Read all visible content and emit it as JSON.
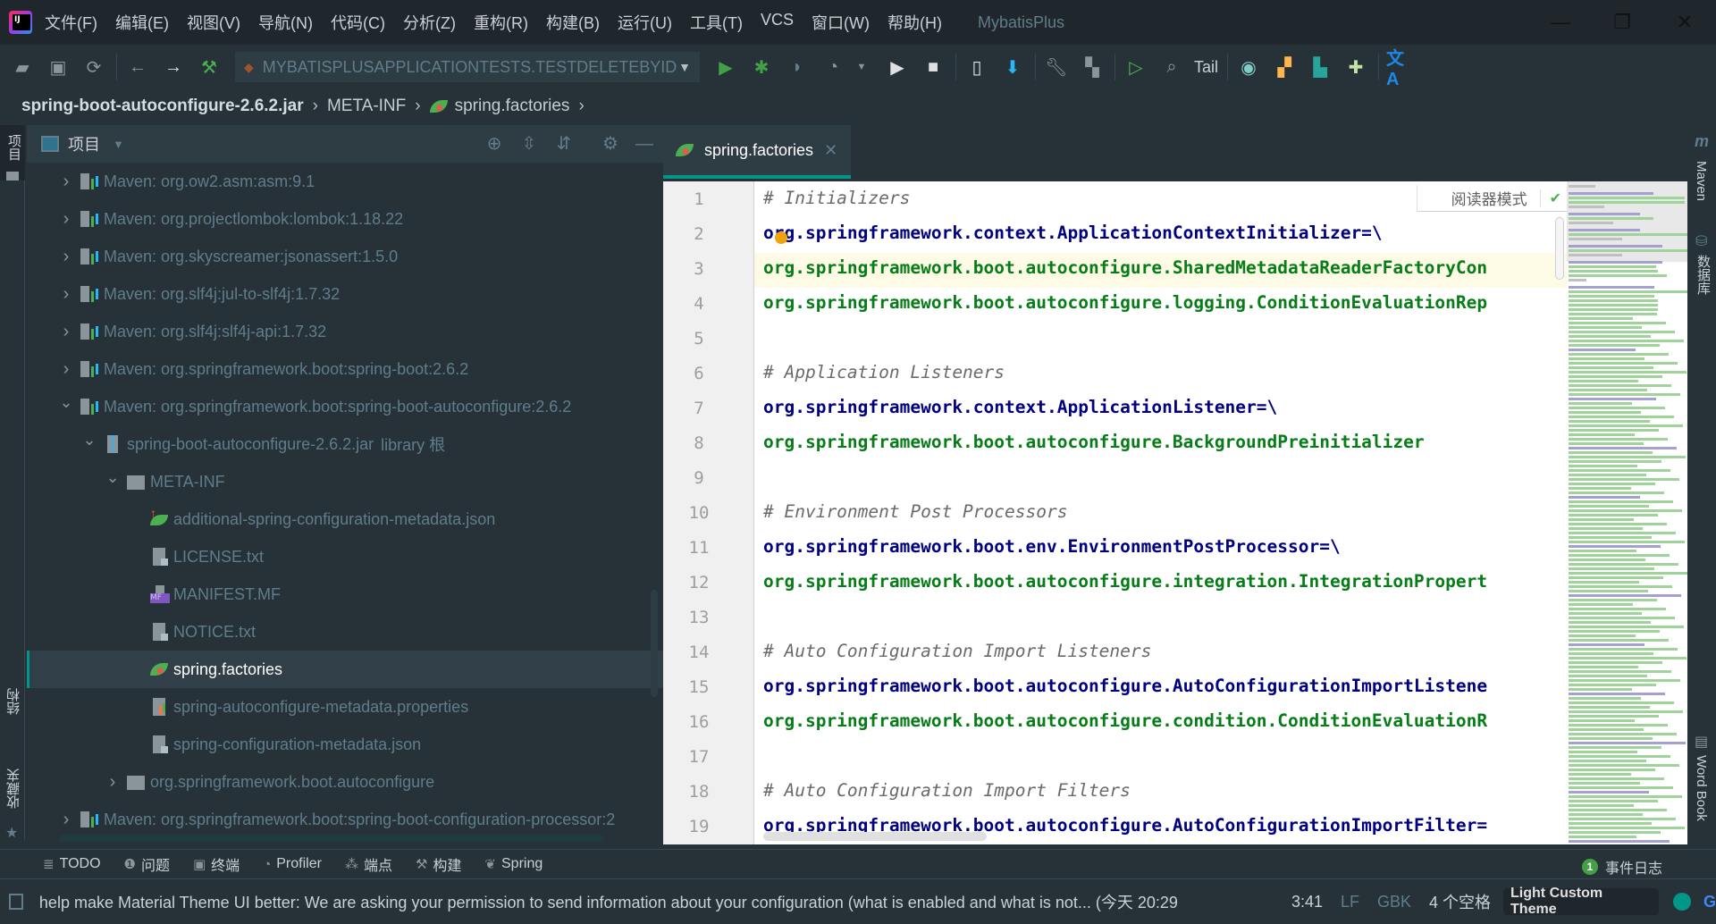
{
  "titlebar": {
    "menu": [
      "文件(F)",
      "编辑(E)",
      "视图(V)",
      "导航(N)",
      "代码(C)",
      "分析(Z)",
      "重构(R)",
      "构建(B)",
      "运行(U)",
      "工具(T)",
      "VCS",
      "窗口(W)",
      "帮助(H)"
    ],
    "project_name": "MybatisPlus",
    "controls": {
      "minimize": "—",
      "restore": "❐",
      "close": "✕"
    }
  },
  "toolbar": {
    "run_config": "MYBATISPLUSAPPLICATIONTESTS.TESTDELETEBYID",
    "tail_label": "Tail",
    "icons": [
      "open-folder-icon",
      "save-icon",
      "sync-icon",
      "back-icon",
      "forward-icon",
      "build-hammer-icon",
      "run-icon",
      "debug-icon",
      "coverage-icon",
      "profile-icon",
      "resume-icon",
      "stop-icon",
      "device-manager-icon",
      "sdk-download-icon",
      "settings-wrench-icon",
      "project-structure-icon",
      "run-anything-icon",
      "search-icon",
      "record-icon",
      "layout-icon",
      "mysql-icon",
      "plugin-icon",
      "translate-icon"
    ]
  },
  "breadcrumb": [
    "spring-boot-autoconfigure-2.6.2.jar",
    "META-INF",
    "spring.factories"
  ],
  "left_strip": {
    "project": "项目",
    "structure": "结构",
    "favorites": "收藏夹"
  },
  "project_panel": {
    "title": "项目",
    "tree": [
      {
        "label": "Maven: org.ow2.asm:asm:9.1",
        "type": "maven",
        "level": 0,
        "expanded": false
      },
      {
        "label": "Maven: org.projectlombok:lombok:1.18.22",
        "type": "maven",
        "level": 0,
        "expanded": false
      },
      {
        "label": "Maven: org.skyscreamer:jsonassert:1.5.0",
        "type": "maven",
        "level": 0,
        "expanded": false
      },
      {
        "label": "Maven: org.slf4j:jul-to-slf4j:1.7.32",
        "type": "maven",
        "level": 0,
        "expanded": false
      },
      {
        "label": "Maven: org.slf4j:slf4j-api:1.7.32",
        "type": "maven",
        "level": 0,
        "expanded": false
      },
      {
        "label": "Maven: org.springframework.boot:spring-boot:2.6.2",
        "type": "maven",
        "level": 0,
        "expanded": false
      },
      {
        "label": "Maven: org.springframework.boot:spring-boot-autoconfigure:2.6.2",
        "type": "maven",
        "level": 0,
        "expanded": true
      },
      {
        "label": "spring-boot-autoconfigure-2.6.2.jar",
        "suffix": "library 根",
        "type": "jar",
        "level": 1,
        "expanded": true
      },
      {
        "label": "META-INF",
        "type": "folder",
        "level": 2,
        "expanded": true
      },
      {
        "label": "additional-spring-configuration-metadata.json",
        "type": "addjson",
        "level": 3
      },
      {
        "label": "LICENSE.txt",
        "type": "file",
        "level": 3
      },
      {
        "label": "MANIFEST.MF",
        "type": "mf",
        "level": 3
      },
      {
        "label": "NOTICE.txt",
        "type": "file",
        "level": 3
      },
      {
        "label": "spring.factories",
        "type": "spring",
        "level": 3,
        "selected": true
      },
      {
        "label": "spring-autoconfigure-metadata.properties",
        "type": "props",
        "level": 3
      },
      {
        "label": "spring-configuration-metadata.json",
        "type": "file",
        "level": 3
      },
      {
        "label": "org.springframework.boot.autoconfigure",
        "type": "folder",
        "level": 2,
        "expanded": false
      },
      {
        "label": "Maven: org.springframework.boot:spring-boot-configuration-processor:2",
        "type": "maven",
        "level": 0,
        "expanded": false
      }
    ]
  },
  "editor": {
    "tab_label": "spring.factories",
    "reader_mode": "阅读器模式",
    "current_line": 3,
    "lines": [
      {
        "n": "1",
        "kind": "comment",
        "text": "# Initializers"
      },
      {
        "n": "2",
        "kind": "key",
        "text": "org.springframework.context.ApplicationContextInitializer=\\"
      },
      {
        "n": "3",
        "kind": "val",
        "text": "org.springframework.boot.autoconfigure.SharedMetadataReaderFactoryCon"
      },
      {
        "n": "4",
        "kind": "val",
        "text": "org.springframework.boot.autoconfigure.logging.ConditionEvaluationRep"
      },
      {
        "n": "5",
        "kind": "blank",
        "text": ""
      },
      {
        "n": "6",
        "kind": "comment",
        "text": "# Application Listeners"
      },
      {
        "n": "7",
        "kind": "key",
        "text": "org.springframework.context.ApplicationListener=\\"
      },
      {
        "n": "8",
        "kind": "val",
        "text": "org.springframework.boot.autoconfigure.BackgroundPreinitializer"
      },
      {
        "n": "9",
        "kind": "blank",
        "text": ""
      },
      {
        "n": "10",
        "kind": "comment",
        "text": "# Environment Post Processors"
      },
      {
        "n": "11",
        "kind": "key",
        "text": "org.springframework.boot.env.EnvironmentPostProcessor=\\"
      },
      {
        "n": "12",
        "kind": "val",
        "text": "org.springframework.boot.autoconfigure.integration.IntegrationPropert"
      },
      {
        "n": "13",
        "kind": "blank",
        "text": ""
      },
      {
        "n": "14",
        "kind": "comment",
        "text": "# Auto Configuration Import Listeners"
      },
      {
        "n": "15",
        "kind": "key",
        "text": "org.springframework.boot.autoconfigure.AutoConfigurationImportListene"
      },
      {
        "n": "16",
        "kind": "val",
        "text": "org.springframework.boot.autoconfigure.condition.ConditionEvaluationR"
      },
      {
        "n": "17",
        "kind": "blank",
        "text": ""
      },
      {
        "n": "18",
        "kind": "comment",
        "text": "# Auto Configuration Import Filters"
      },
      {
        "n": "19",
        "kind": "key",
        "text": "org.springframework.boot.autoconfigure.AutoConfigurationImportFilter="
      }
    ]
  },
  "right_strip": {
    "maven": "Maven",
    "database": "数据库",
    "wordbook": "Word Book"
  },
  "bottom_tabs": [
    {
      "label": "TODO",
      "icon": "todo-list-icon",
      "glyph": "≣"
    },
    {
      "label": "问题",
      "icon": "problems-icon",
      "glyph": "❶"
    },
    {
      "label": "终端",
      "icon": "terminal-icon",
      "glyph": "▣"
    },
    {
      "label": "Profiler",
      "icon": "profiler-icon",
      "glyph": "◔"
    },
    {
      "label": "端点",
      "icon": "endpoints-icon",
      "glyph": "⁂"
    },
    {
      "label": "构建",
      "icon": "build-icon",
      "glyph": "⚒"
    },
    {
      "label": "Spring",
      "icon": "spring-leaf-icon",
      "glyph": "❦"
    }
  ],
  "event_log": {
    "count": "1",
    "label": "事件日志"
  },
  "statusbar": {
    "message": "help make Material Theme UI better: We are asking your permission to send information about your configuration (what is enabled and what is not... (今天 20:29",
    "position": "3:41",
    "line_separator": "LF",
    "encoding": "GBK",
    "indent": "4 个空格",
    "theme": "Light Custom Theme"
  }
}
